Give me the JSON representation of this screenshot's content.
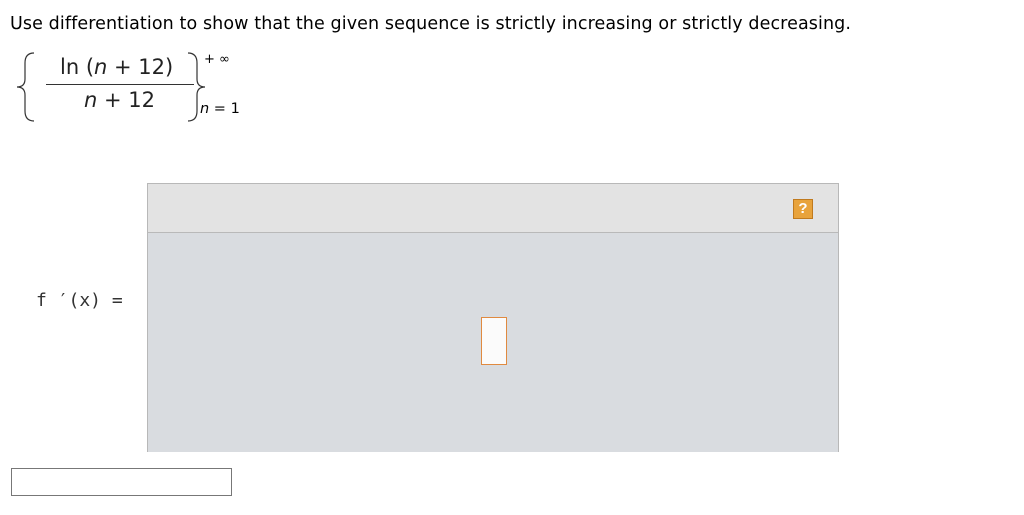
{
  "question": {
    "instruction": "Use differentiation to show that the given sequence is strictly increasing or strictly decreasing."
  },
  "sequence": {
    "numerator_fn": "ln",
    "numerator_open": " (",
    "numerator_var": "n",
    "numerator_rest": " + 12)",
    "denominator_var": "n",
    "denominator_rest": " + 12",
    "upper_limit": "+ ∞",
    "lower_var": "n",
    "lower_rest": " = 1"
  },
  "derivative": {
    "label": "f ′(x) ="
  },
  "editor": {
    "help_label": "?"
  },
  "answer": {
    "value": ""
  },
  "colors": {
    "help_button": "#e8a33c",
    "math_box_border": "#e08a40",
    "panel_background": "#d9dce0",
    "toolbar_background": "#e3e3e3"
  }
}
